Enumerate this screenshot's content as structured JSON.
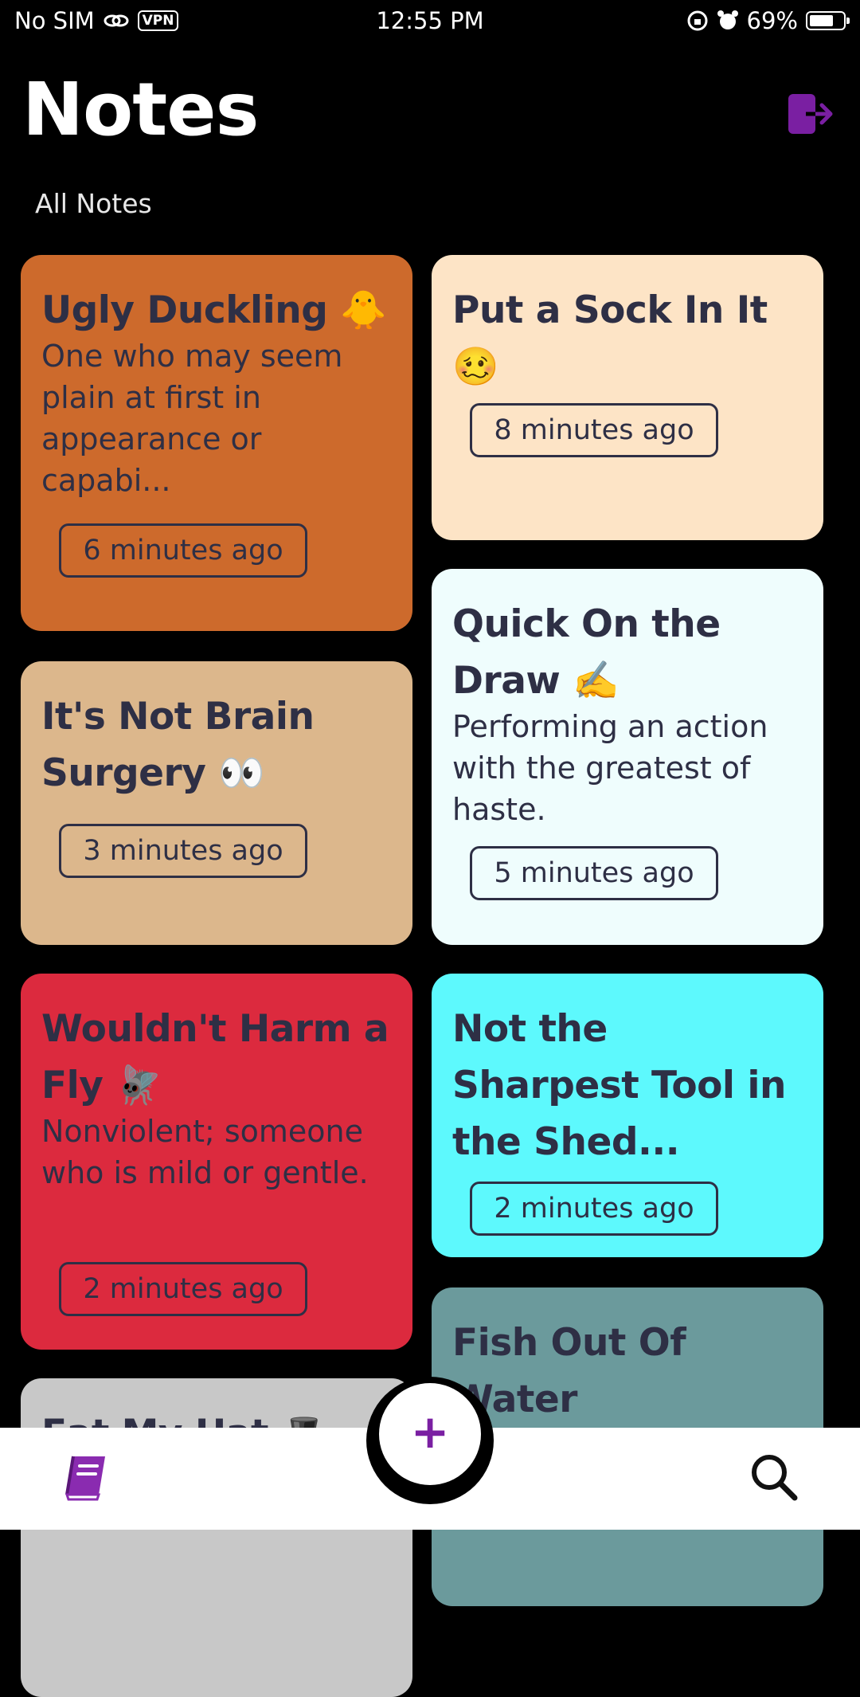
{
  "status_bar": {
    "carrier": "No SIM",
    "vpn": "VPN",
    "time": "12:55 PM",
    "battery": "69%",
    "battery_level": 0.69
  },
  "header": {
    "title": "Notes",
    "subtitle": "All Notes",
    "logout_icon": "logout-icon",
    "accent_color": "#7a1fa2"
  },
  "notes": [
    {
      "title": "Ugly Duckling 🐥",
      "body": "One who may seem plain at first in appearance or capabi...",
      "time": "6 minutes ago",
      "color": "#cd6a2c"
    },
    {
      "title": "Put a Sock In It 🥴",
      "body": "",
      "time": "8 minutes ago",
      "color": "#fde4c6"
    },
    {
      "title": "It's Not Brain Surgery 👀",
      "body": "",
      "time": "3 minutes ago",
      "color": "#dcb78c"
    },
    {
      "title": "Quick On the Draw ✍️",
      "body": "Performing an action with the greatest of haste.",
      "time": "5 minutes ago",
      "color": "#effdfd"
    },
    {
      "title": "Wouldn't Harm a Fly 🪰",
      "body": "Nonviolent; someone who is mild or gentle.",
      "time": "2 minutes ago",
      "color": "#dc2a3e"
    },
    {
      "title": "Not the Sharpest Tool in the Shed...",
      "body": "",
      "time": "2 minutes ago",
      "color": "#5df9fd"
    },
    {
      "title": "Fish Out Of Water",
      "body": "",
      "time": "",
      "color": "#6b9a9c"
    },
    {
      "title": "Eat My Hat 🎩",
      "body": "",
      "time": "",
      "color": "#c8c8c8"
    }
  ],
  "nav": {
    "add_label": "+",
    "left_icon": "notebook-icon",
    "right_icon": "search-icon"
  }
}
